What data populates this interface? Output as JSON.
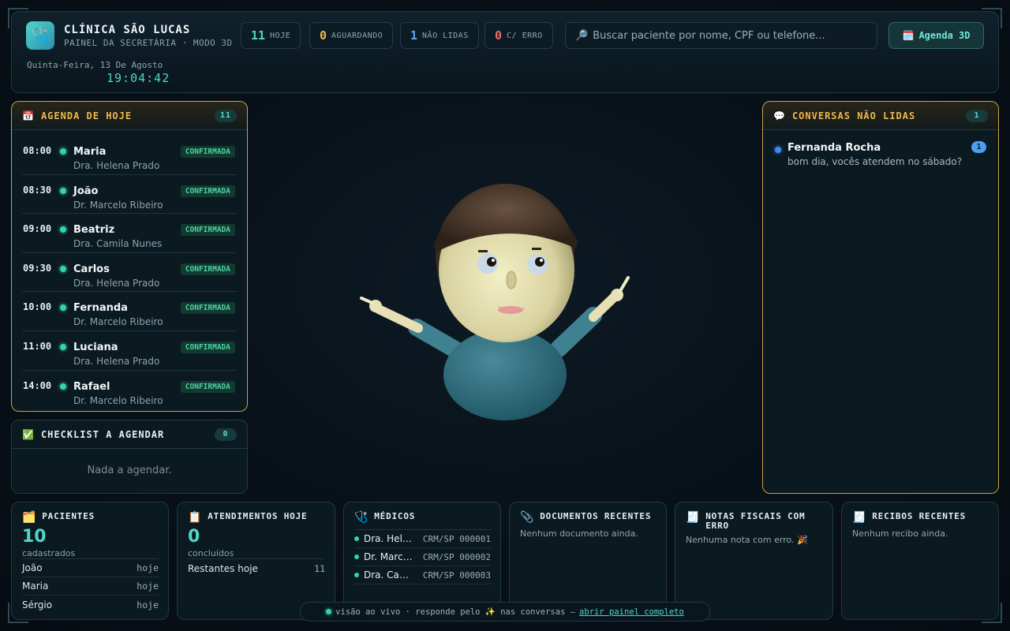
{
  "header": {
    "clinic_name": "CLÍNICA SÃO LUCAS",
    "subtitle": "PAINEL DA SECRETÁRIA · MODO 3D",
    "date": "Quinta-Feira, 13 De Agosto",
    "clock": "19:04:42",
    "stats": [
      {
        "value": "11",
        "label": "HOJE",
        "color": "#4fd6c9"
      },
      {
        "value": "0",
        "label": "AGUARDANDO",
        "color": "#f0b64c"
      },
      {
        "value": "1",
        "label": "NÃO LIDAS",
        "color": "#5aa8f5"
      },
      {
        "value": "0",
        "label": "C/ ERRO",
        "color": "#f06b6b"
      }
    ],
    "search_placeholder": "Buscar paciente por nome, CPF ou telefone...",
    "agenda3d_label": "Agenda 3D"
  },
  "agenda": {
    "title": "AGENDA DE HOJE",
    "count": "11",
    "items": [
      {
        "time": "08:00",
        "name": "Maria",
        "doctor": "Dra. Helena Prado",
        "status": "CONFIRMADA"
      },
      {
        "time": "08:30",
        "name": "João",
        "doctor": "Dr. Marcelo Ribeiro",
        "status": "CONFIRMADA"
      },
      {
        "time": "09:00",
        "name": "Beatriz",
        "doctor": "Dra. Camila Nunes",
        "status": "CONFIRMADA"
      },
      {
        "time": "09:30",
        "name": "Carlos",
        "doctor": "Dra. Helena Prado",
        "status": "CONFIRMADA"
      },
      {
        "time": "10:00",
        "name": "Fernanda",
        "doctor": "Dr. Marcelo Ribeiro",
        "status": "CONFIRMADA"
      },
      {
        "time": "11:00",
        "name": "Luciana",
        "doctor": "Dra. Helena Prado",
        "status": "CONFIRMADA"
      },
      {
        "time": "14:00",
        "name": "Rafael",
        "doctor": "Dr. Marcelo Ribeiro",
        "status": "CONFIRMADA"
      }
    ]
  },
  "checklist": {
    "title": "CHECKLIST A AGENDAR",
    "count": "0",
    "empty": "Nada a agendar."
  },
  "conversas": {
    "title": "CONVERSAS NÃO LIDAS",
    "count": "1",
    "items": [
      {
        "name": "Fernanda Rocha",
        "message": "bom dia, vocês atendem no sábado?",
        "unread": "1"
      }
    ]
  },
  "cards": {
    "pacientes": {
      "title": "PACIENTES",
      "value": "10",
      "sub": "cadastrados",
      "rows": [
        {
          "name": "João",
          "when": "hoje"
        },
        {
          "name": "Maria",
          "when": "hoje"
        },
        {
          "name": "Sérgio",
          "when": "hoje"
        }
      ]
    },
    "atendimentos": {
      "title": "ATENDIMENTOS HOJE",
      "value": "0",
      "sub": "concluídos",
      "rows": [
        {
          "name": "Restantes hoje",
          "when": "11"
        }
      ]
    },
    "medicos": {
      "title": "MÉDICOS",
      "rows": [
        {
          "name": "Dra. Helena Prado",
          "crm": "CRM/SP 000001"
        },
        {
          "name": "Dr. Marcelo Ribeiro",
          "crm": "CRM/SP 000002"
        },
        {
          "name": "Dra. Camila Nunes",
          "crm": "CRM/SP 000003"
        }
      ]
    },
    "documentos": {
      "title": "DOCUMENTOS RECENTES",
      "empty": "Nenhum documento ainda."
    },
    "notas": {
      "title": "NOTAS FISCAIS COM ERRO",
      "empty": "Nenhuma nota com erro. 🎉"
    },
    "recibos": {
      "title": "RECIBOS RECENTES",
      "empty": "Nenhum recibo ainda."
    }
  },
  "live_bar": {
    "text": "visão ao vivo · responde pelo ✨ nas conversas —",
    "link": "abrir painel completo"
  },
  "icons": {
    "logo": "stethoscope-icon",
    "search": "search-icon",
    "calendar": "calendar-icon",
    "check": "check-icon",
    "chat": "chat-icon"
  }
}
